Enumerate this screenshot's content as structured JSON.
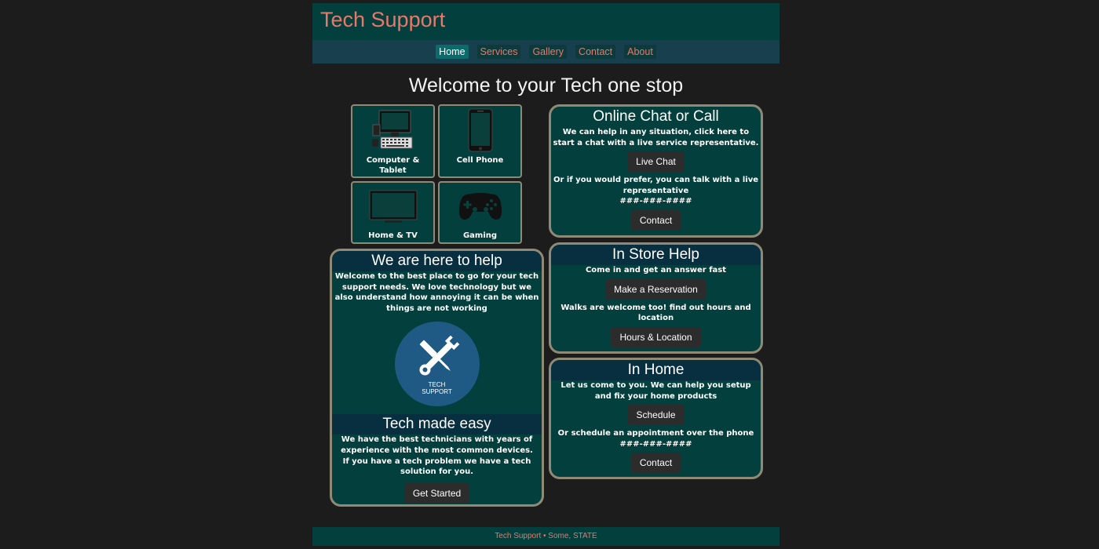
{
  "site_title": "Tech Support",
  "nav": {
    "home": "Home",
    "services": "Services",
    "gallery": "Gallery",
    "contact": "Contact",
    "about": "About"
  },
  "welcome": "Welcome to your Tech one stop",
  "tiles": [
    {
      "label": "Computer & Tablet",
      "icon": "desktop-computer-icon"
    },
    {
      "label": "Cell Phone",
      "icon": "cell-phone-icon"
    },
    {
      "label": "Home & TV",
      "icon": "television-icon"
    },
    {
      "label": "Gaming",
      "icon": "game-controller-icon"
    }
  ],
  "help_panel": {
    "title": "We are here to help",
    "text": "Welcome to the best place to go for your tech support needs. We love technology but we also understand how annoying it can be when things are not working",
    "logo_text": "TECH SUPPORT",
    "logo_icon": "wrench-screwdriver-icon",
    "sub_title": "Tech made easy",
    "sub_text": "We have the best technicians with years of experience with the most common devices. If you have a tech problem we have a tech solution for you.",
    "button": "Get Started"
  },
  "chat_panel": {
    "title": "Online Chat or Call",
    "text1": "We can help in any situation, click here to start a chat with a live service representative.",
    "button1": "Live Chat",
    "text2": "Or if you would prefer, you can talk with a live representative",
    "phone": "###-###-####",
    "button2": "Contact"
  },
  "store_panel": {
    "title": "In Store Help",
    "text1": "Come in and get an answer fast",
    "button1": "Make a Reservation",
    "text2": "Walks are welcome too! find out hours and location",
    "button2": "Hours & Location"
  },
  "home_panel": {
    "title": "In Home",
    "text1": "Let us come to you. We can help you setup and fix your home products",
    "button1": "Schedule",
    "text2": "Or schedule an appointment over the phone",
    "phone": "###-###-####",
    "button2": "Contact"
  },
  "footer": "Tech Support • Some, STATE",
  "colors": {
    "page_bg": "#1c1c1c",
    "header_bg": "#03403d",
    "nav_bg": "#173f4d",
    "accent_text": "#e8786a",
    "panel_border": "#8e8a76",
    "panel_head_bg": "#082f40",
    "button_bg": "#2c2c2c",
    "logo_bg": "#1f5a85"
  }
}
